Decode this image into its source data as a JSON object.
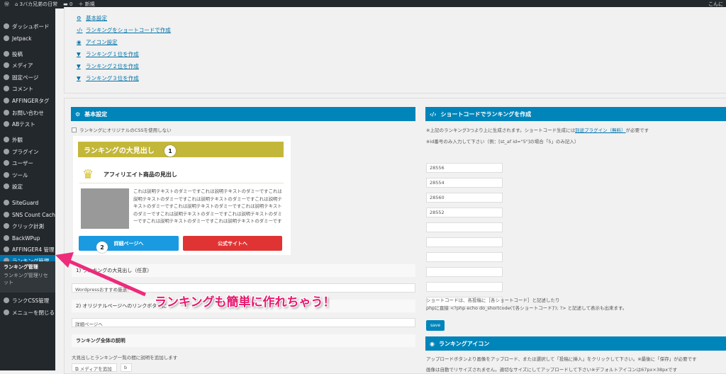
{
  "adminbar": {
    "site": "3バカ兄弟の日常",
    "comments": "0",
    "new": "新規",
    "greeting": "こんに"
  },
  "sidebar": {
    "items": [
      "ダッシュボード",
      "Jetpack",
      "投稿",
      "メディア",
      "固定ページ",
      "コメント",
      "AFFINGERタグ",
      "お問い合わせ",
      "ABテスト",
      "外観",
      "プラグイン",
      "ユーザー",
      "ツール",
      "設定",
      "SiteGuard",
      "SNS Count Cache",
      "クリック計測",
      "BackWPup",
      "AFFINGER4 管理",
      "ランキング管理",
      "ランクCSS管理",
      "メニューを閉じる"
    ],
    "submenu": [
      "ランキング管理",
      "ランキング管理リセット"
    ]
  },
  "toc": [
    "基本設定",
    "ランキングをショートコードで作成",
    "アイコン設定",
    "ランキング１位を作成",
    "ランキング２位を作成",
    "ランキング３位を作成"
  ],
  "basic": {
    "title": "基本設定",
    "checkbox_label": "ランキングにオリジナルのCSSを使用しない",
    "preview": {
      "heading": "ランキングの大見出し",
      "item_title": "アフィリエイト商品の見出し",
      "text": "これは説明テキストのダミーですこれは説明テキストのダミーですこれは説明テキストのダミーですこれは説明テキストのダミーですこれは説明テキストのダミーですこれは説明テキストのダミーですこれは説明テキストのダミーですこれは説明テキストのダミーですこれは説明テキストのダミーですこれは説明テキストのダミーですこれは説明テキストのダミーです",
      "detail_btn": "詳細ページへ",
      "official_btn": "公式サイトへ",
      "marker1": "1",
      "marker2": "2"
    },
    "label1": "1) ランキングの大見出し（任意）",
    "value1": "Wordpressおすすめ厳選！",
    "label2": "2) オリジナルページへのリンクボタンに",
    "value2": "詳細ページへ",
    "label3": "ランキング全体の説明",
    "desc": "大見出しとランキング一覧の間に説明を追加します",
    "media_btn": "メディアを追加",
    "b_btn": "b"
  },
  "shortcode": {
    "title": "ショートコードでランキングを作成",
    "note1a": "※上記のランキング3つより上に生成されます。ショートコード生成には",
    "note1link": "別途プラグイン（無料）",
    "note1b": "が必要です",
    "note2": "※id番号のみ入力して下さい（例：[st_af id=\"5\"]の場合「5」のみ記入）",
    "ids": [
      "28556",
      "28554",
      "28560",
      "28552",
      "",
      "",
      "",
      "",
      "",
      ""
    ],
    "help1": "ショートコードは、各投稿に［各ショートコード］と記述したり",
    "help2": "phpに直接 <?php echo do_shortcode('[各ショートコード]'); ?> と記述して表示も出来ます。",
    "save": "save"
  },
  "icon": {
    "title": "ランキングアイコン",
    "text1": "アップロードボタンより画像をアップロード、または選択して「投稿に挿入」をクリックして下さい。※最後に「保存」が必要です",
    "text2": "画像は自動でリサイズされません。適切なサイズにしてアップロードして下さい※デフォルトアイコンは67px×38pxです"
  },
  "annotation": "ランキングも簡単に作れちゃう！"
}
